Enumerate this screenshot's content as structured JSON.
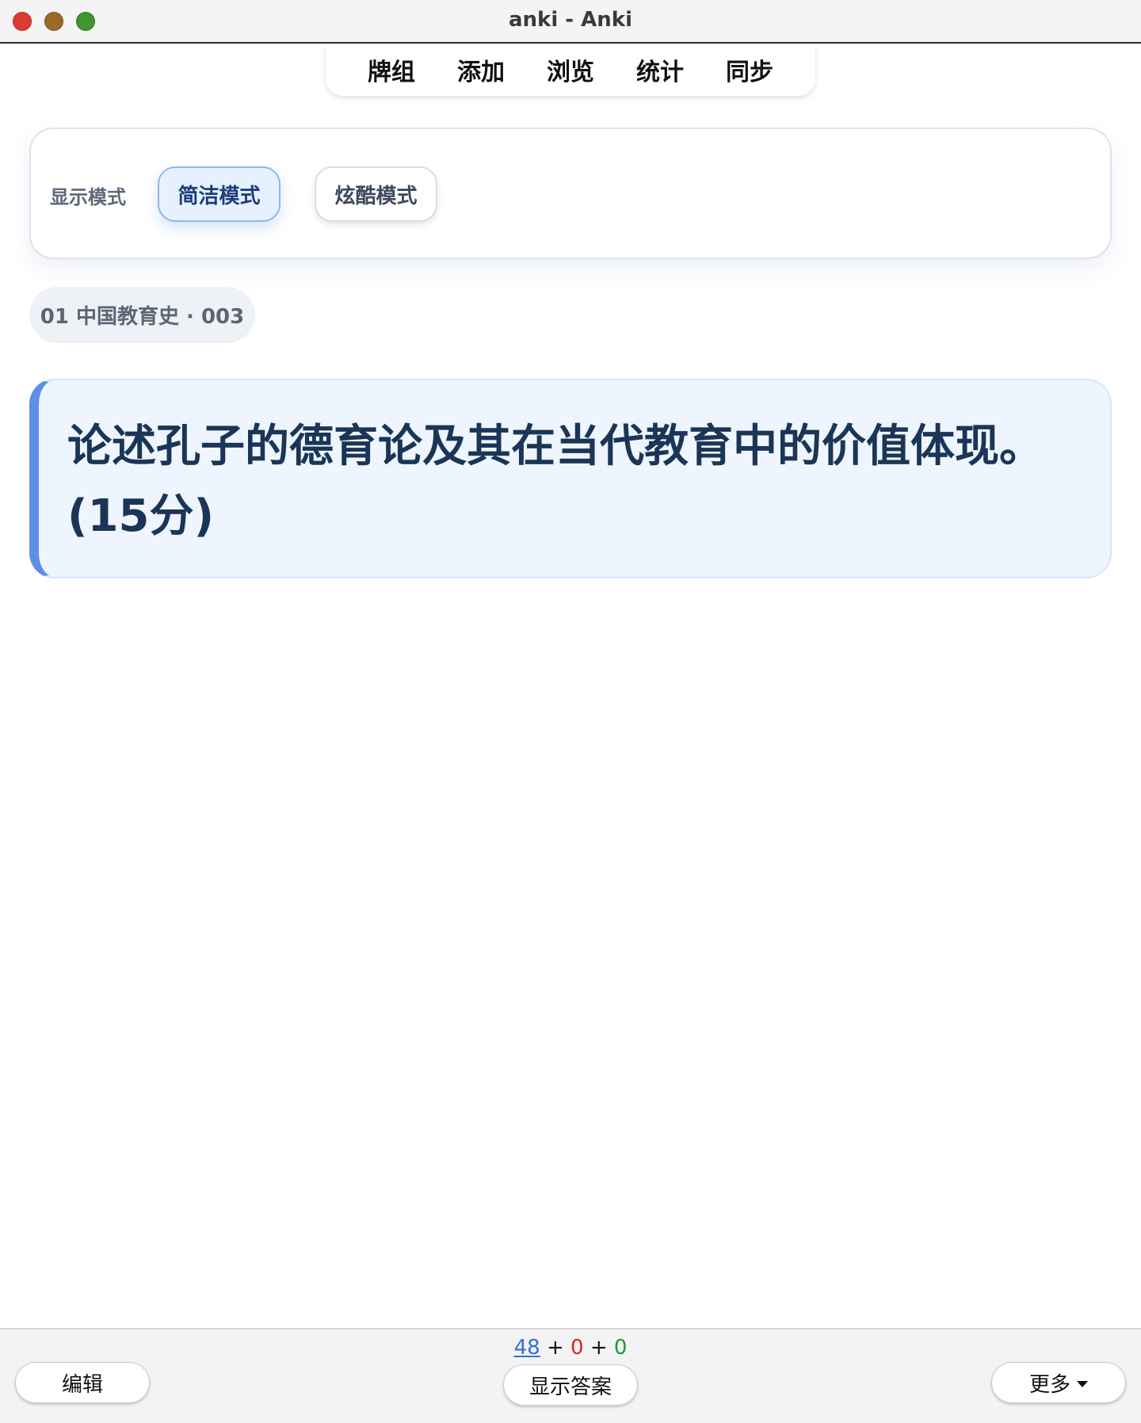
{
  "window": {
    "title": "anki - Anki"
  },
  "topnav": {
    "items": [
      {
        "label": "牌组"
      },
      {
        "label": "添加"
      },
      {
        "label": "浏览"
      },
      {
        "label": "统计"
      },
      {
        "label": "同步"
      }
    ]
  },
  "display_mode": {
    "label": "显示模式",
    "options": [
      {
        "label": "简洁模式",
        "selected": true
      },
      {
        "label": "炫酷模式",
        "selected": false
      }
    ]
  },
  "card": {
    "deck_tag": "01 中国教育史 · 003",
    "question": "论述孔子的德育论及其在当代教育中的价值体现。(15分)"
  },
  "bottom": {
    "edit_label": "编辑",
    "show_answer_label": "显示答案",
    "more_label": "更多",
    "counts": {
      "new": "48",
      "learning": "0",
      "review": "0",
      "separator": "+"
    }
  },
  "colors": {
    "accent": "#5d8fe6",
    "new_count": "#3470d8",
    "learning_count": "#d22a2a",
    "review_count": "#1c9a3a"
  }
}
